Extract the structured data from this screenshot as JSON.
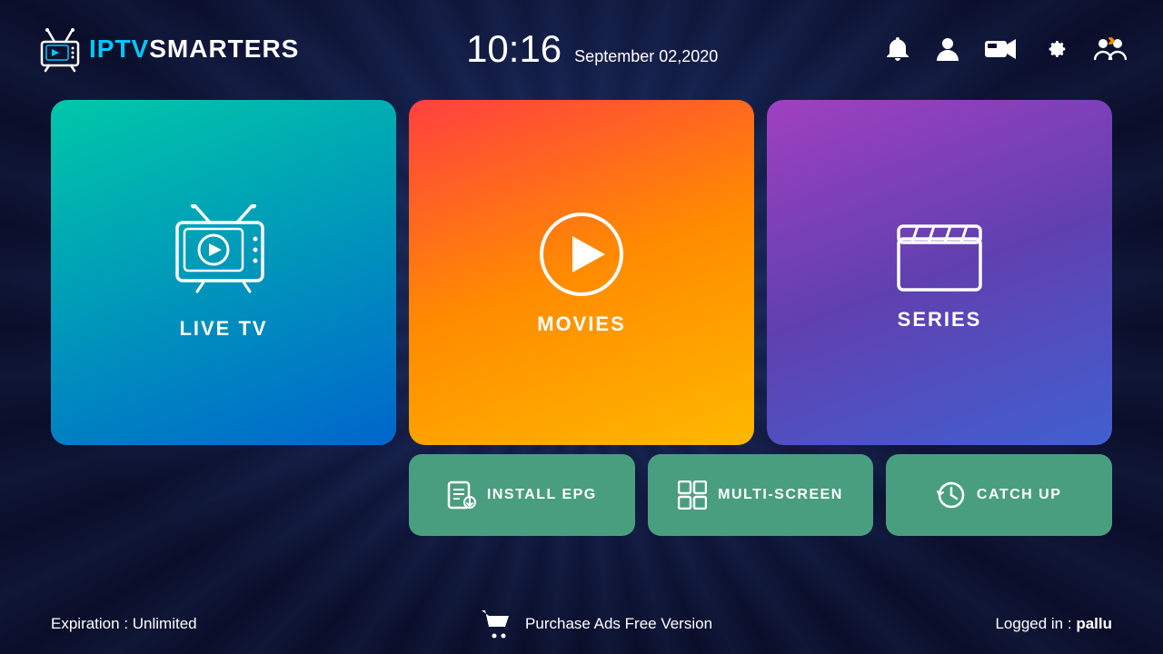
{
  "header": {
    "logo_iptv": "IPTV",
    "logo_smarters": "SMARTERS",
    "time": "10:16",
    "date": "September 02,2020",
    "icons": {
      "bell": "🔔",
      "user": "👤",
      "record": "⏺",
      "settings": "⚙",
      "switch_user": "🔄"
    }
  },
  "cards": {
    "live_tv": {
      "label": "LIVE TV"
    },
    "movies": {
      "label": "MOVIES"
    },
    "series": {
      "label": "SERIES"
    },
    "install_epg": {
      "label": "INSTALL EPG"
    },
    "multi_screen": {
      "label": "MULTI-SCREEN"
    },
    "catch_up": {
      "label": "CATCH UP"
    }
  },
  "footer": {
    "expiration_label": "Expiration : ",
    "expiration_value": "Unlimited",
    "purchase_text": "Purchase Ads Free Version",
    "logged_in_label": "Logged in : ",
    "logged_in_user": "pallu"
  }
}
